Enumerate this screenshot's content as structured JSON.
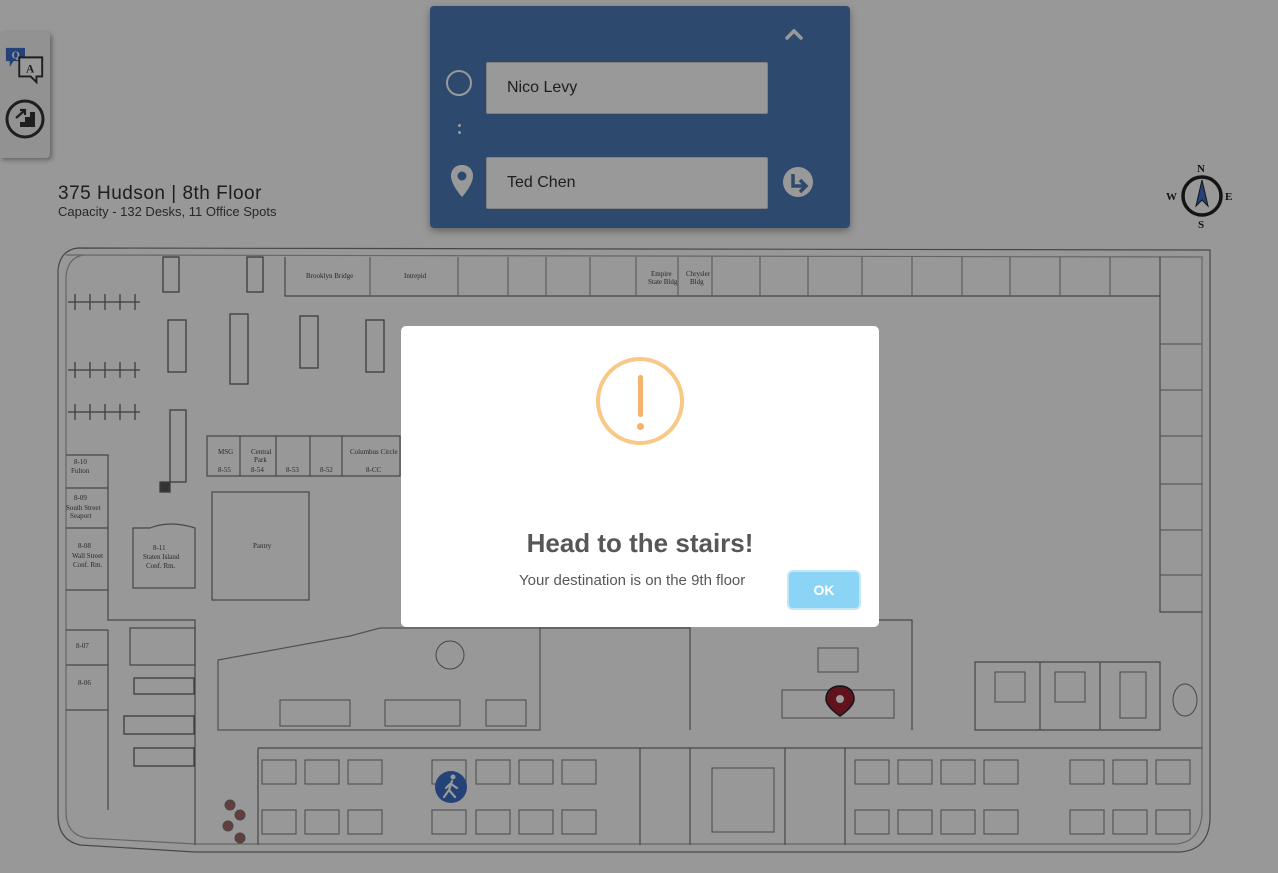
{
  "header": {
    "title": "375 Hudson | 8th Floor",
    "subtitle": "Capacity - 132 Desks, 11 Office Spots"
  },
  "toolbar": {
    "qa_icon_letters": [
      "Q",
      "A"
    ],
    "items": [
      {
        "name": "qa-button",
        "icon": "question-answer-icon"
      },
      {
        "name": "stairs-button",
        "icon": "stairs-icon"
      }
    ]
  },
  "route": {
    "origin_value": "Nico Levy",
    "destination_value": "Ted Chen",
    "accent_color": "#4e7bb8"
  },
  "compass": {
    "n": "N",
    "s": "S",
    "e": "E",
    "w": "W"
  },
  "rooms": {
    "brooklyn": "Brooklyn Bridge",
    "intrepid": "Intrepid",
    "empire_1": "Empire",
    "empire_2": "State Bldg",
    "chrysler_1": "Chrysler",
    "chrysler_2": "Bldg",
    "msg": "MSG",
    "central_1": "Central",
    "central_2": "Park",
    "columbus": "Columbus Circle",
    "pantry": "Pantry",
    "fulton_num": "8-10",
    "fulton": "Fulton",
    "seaport_num": "8-09",
    "seaport_1": "South Street",
    "seaport_2": "Seaport",
    "wallst_num": "8-08",
    "wallst_1": "Wall Street",
    "wallst_2": "Conf. Rm.",
    "staten_num": "8-11",
    "staten_1": "Staten Island",
    "staten_2": "Conf. Rm.",
    "r807": "8-07",
    "r806": "8-06",
    "r855": "8-55",
    "r854": "8-54",
    "r853": "8-53",
    "r852": "8-52",
    "r8cc": "8-CC"
  },
  "modal": {
    "title": "Head to the stairs!",
    "text": "Your destination is on the 9th floor",
    "ok_label": "OK",
    "warning_color": "#f8c886",
    "button_color": "#8cd4f5"
  }
}
